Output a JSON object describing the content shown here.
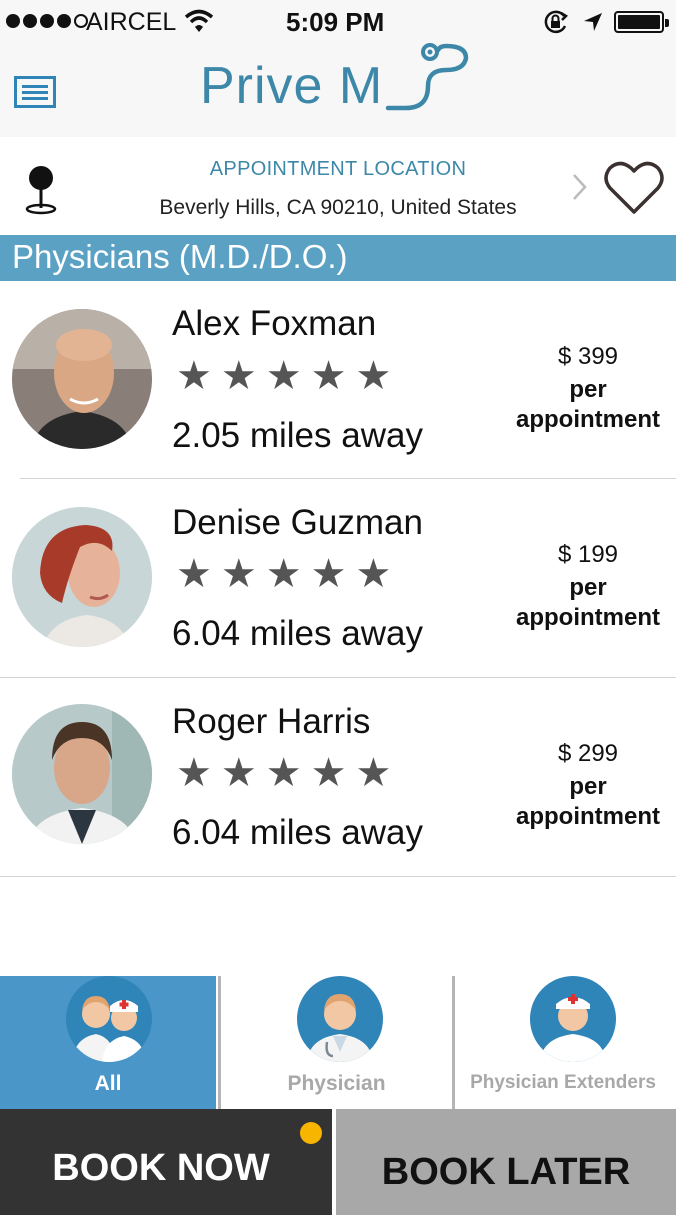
{
  "status_bar": {
    "carrier": "AIRCEL",
    "time": "5:09 PM",
    "signal_bars": 4,
    "icons": [
      "signal-dots-icon",
      "wifi-icon",
      "rotation-lock-icon",
      "location-arrow-icon",
      "battery-icon"
    ]
  },
  "header": {
    "logo_text": "Prive M",
    "menu_icon": "menu-icon",
    "logo_icon": "stethoscope-icon"
  },
  "location": {
    "title": "APPOINTMENT LOCATION",
    "address": "Beverly Hills, CA 90210, United States",
    "pin_icon": "map-pin-icon",
    "chevron_icon": "chevron-right-icon",
    "favorite_icon": "heart-icon"
  },
  "section": {
    "title": "Physicians (M.D./D.O.)"
  },
  "doctors": [
    {
      "name": "Alex Foxman",
      "rating": 5,
      "stars": "★★★★★",
      "distance": "2.05 miles away",
      "price": "$ 399",
      "per": "per",
      "unit": "appointment"
    },
    {
      "name": "Denise Guzman",
      "rating": 5,
      "stars": "★★★★★",
      "distance": "6.04 miles away",
      "price": "$ 199",
      "per": "per",
      "unit": "appointment"
    },
    {
      "name": "Roger Harris",
      "rating": 5,
      "stars": "★★★★★",
      "distance": "6.04 miles away",
      "price": "$ 299",
      "per": "per",
      "unit": "appointment"
    }
  ],
  "tabs": [
    {
      "label": "All",
      "active": true
    },
    {
      "label": "Physician",
      "active": false
    },
    {
      "label": "Physician Extenders",
      "active": false
    }
  ],
  "actions": {
    "book_now": "BOOK NOW",
    "book_later": "BOOK LATER"
  },
  "colors": {
    "brand": "#3d88a9",
    "section_bg": "#5ba1c4",
    "active_tab": "#4a96c8",
    "book_now_bg": "#333333",
    "book_later_bg": "#a8a8a8",
    "notification": "#f7b500"
  }
}
